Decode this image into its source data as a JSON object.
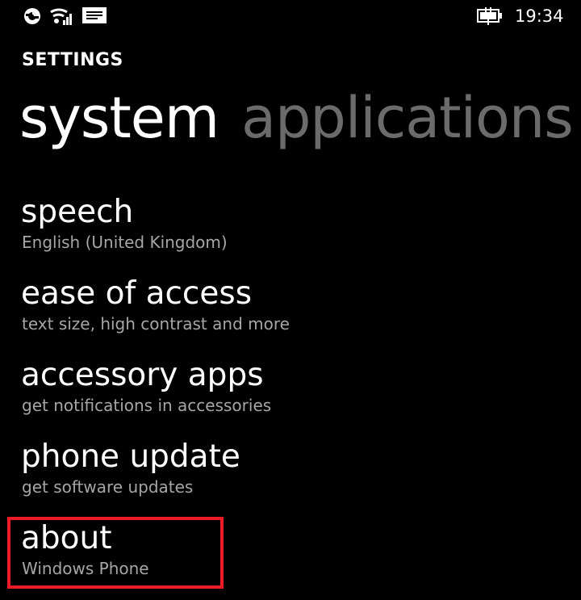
{
  "status_bar": {
    "time": "19:34",
    "icons": [
      "sync-icon",
      "wifi-signal-icon",
      "message-icon",
      "battery-charging-icon"
    ]
  },
  "app_title": "SETTINGS",
  "pivot": {
    "active": "system",
    "next": "applications"
  },
  "items": [
    {
      "title": "speech",
      "subtitle": "English (United Kingdom)"
    },
    {
      "title": "ease of access",
      "subtitle": "text size, high contrast and more"
    },
    {
      "title": "accessory apps",
      "subtitle": "get notifications in accessories"
    },
    {
      "title": "phone update",
      "subtitle": "get software updates"
    },
    {
      "title": "about",
      "subtitle": "Windows Phone"
    }
  ],
  "highlighted_item": "about",
  "colors": {
    "background": "#000000",
    "text": "#ffffff",
    "subtitle": "#a6a6a6",
    "inactive_pivot": "#6b6b6b",
    "highlight": "#ee1c25"
  }
}
